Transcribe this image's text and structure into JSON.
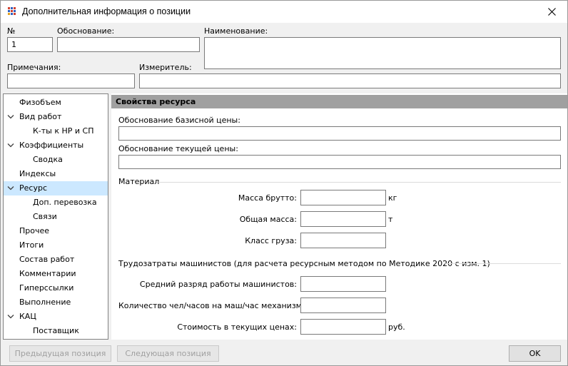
{
  "window": {
    "title": "Дополнительная информация о позиции"
  },
  "header": {
    "number_label": "№",
    "number_value": "1",
    "basis_label": "Обоснование:",
    "basis_value": "",
    "name_label": "Наименование:",
    "name_value": "",
    "notes_label": "Примечания:",
    "notes_value": "",
    "unit_label": "Измеритель:",
    "unit_value": ""
  },
  "nav": {
    "items": [
      {
        "label": "Физобъем",
        "level": 0,
        "expandable": false,
        "selected": false
      },
      {
        "label": "Вид работ",
        "level": 0,
        "expandable": true,
        "selected": false
      },
      {
        "label": "К-ты к НР и СП",
        "level": 1,
        "expandable": false,
        "selected": false
      },
      {
        "label": "Коэффициенты",
        "level": 0,
        "expandable": true,
        "selected": false
      },
      {
        "label": "Сводка",
        "level": 1,
        "expandable": false,
        "selected": false
      },
      {
        "label": "Индексы",
        "level": 0,
        "expandable": false,
        "selected": false
      },
      {
        "label": "Ресурс",
        "level": 0,
        "expandable": true,
        "selected": true
      },
      {
        "label": "Доп. перевозка",
        "level": 1,
        "expandable": false,
        "selected": false
      },
      {
        "label": "Связи",
        "level": 1,
        "expandable": false,
        "selected": false
      },
      {
        "label": "Прочее",
        "level": 0,
        "expandable": false,
        "selected": false
      },
      {
        "label": "Итоги",
        "level": 0,
        "expandable": false,
        "selected": false
      },
      {
        "label": "Состав работ",
        "level": 0,
        "expandable": false,
        "selected": false
      },
      {
        "label": "Комментарии",
        "level": 0,
        "expandable": false,
        "selected": false
      },
      {
        "label": "Гиперссылки",
        "level": 0,
        "expandable": false,
        "selected": false
      },
      {
        "label": "Выполнение",
        "level": 0,
        "expandable": false,
        "selected": false
      },
      {
        "label": "КАЦ",
        "level": 0,
        "expandable": true,
        "selected": false
      },
      {
        "label": "Поставщик",
        "level": 1,
        "expandable": false,
        "selected": false
      }
    ]
  },
  "content": {
    "section_title": "Свойства ресурса",
    "base_price_basis_label": "Обоснование базисной цены:",
    "base_price_basis_value": "",
    "current_price_basis_label": "Обоснование текущей цены:",
    "current_price_basis_value": "",
    "material_group": {
      "title": "Материал",
      "gross_mass_label": "Масса брутто:",
      "gross_mass_value": "",
      "gross_mass_unit": "кг",
      "total_mass_label": "Общая масса:",
      "total_mass_value": "",
      "total_mass_unit": "т",
      "cargo_class_label": "Класс груза:",
      "cargo_class_value": ""
    },
    "labor_group": {
      "title": "Трудозатраты машинистов (для расчета ресурсным методом по Методике 2020 с изм. 1)",
      "avg_grade_label": "Средний разряд работы машинистов:",
      "avg_grade_value": "",
      "hours_label": "Количество чел/часов на маш/час механизма:",
      "hours_value": "",
      "cost_label": "Стоимость в текущих ценах:",
      "cost_value": "",
      "cost_unit": "руб."
    }
  },
  "footer": {
    "prev_label": "Предыдущая позиция",
    "next_label": "Следующая позиция",
    "ok_label": "OK"
  },
  "colors": {
    "selection": "#cce8ff",
    "section_header": "#a0a0a0",
    "chevron": "#404040"
  }
}
